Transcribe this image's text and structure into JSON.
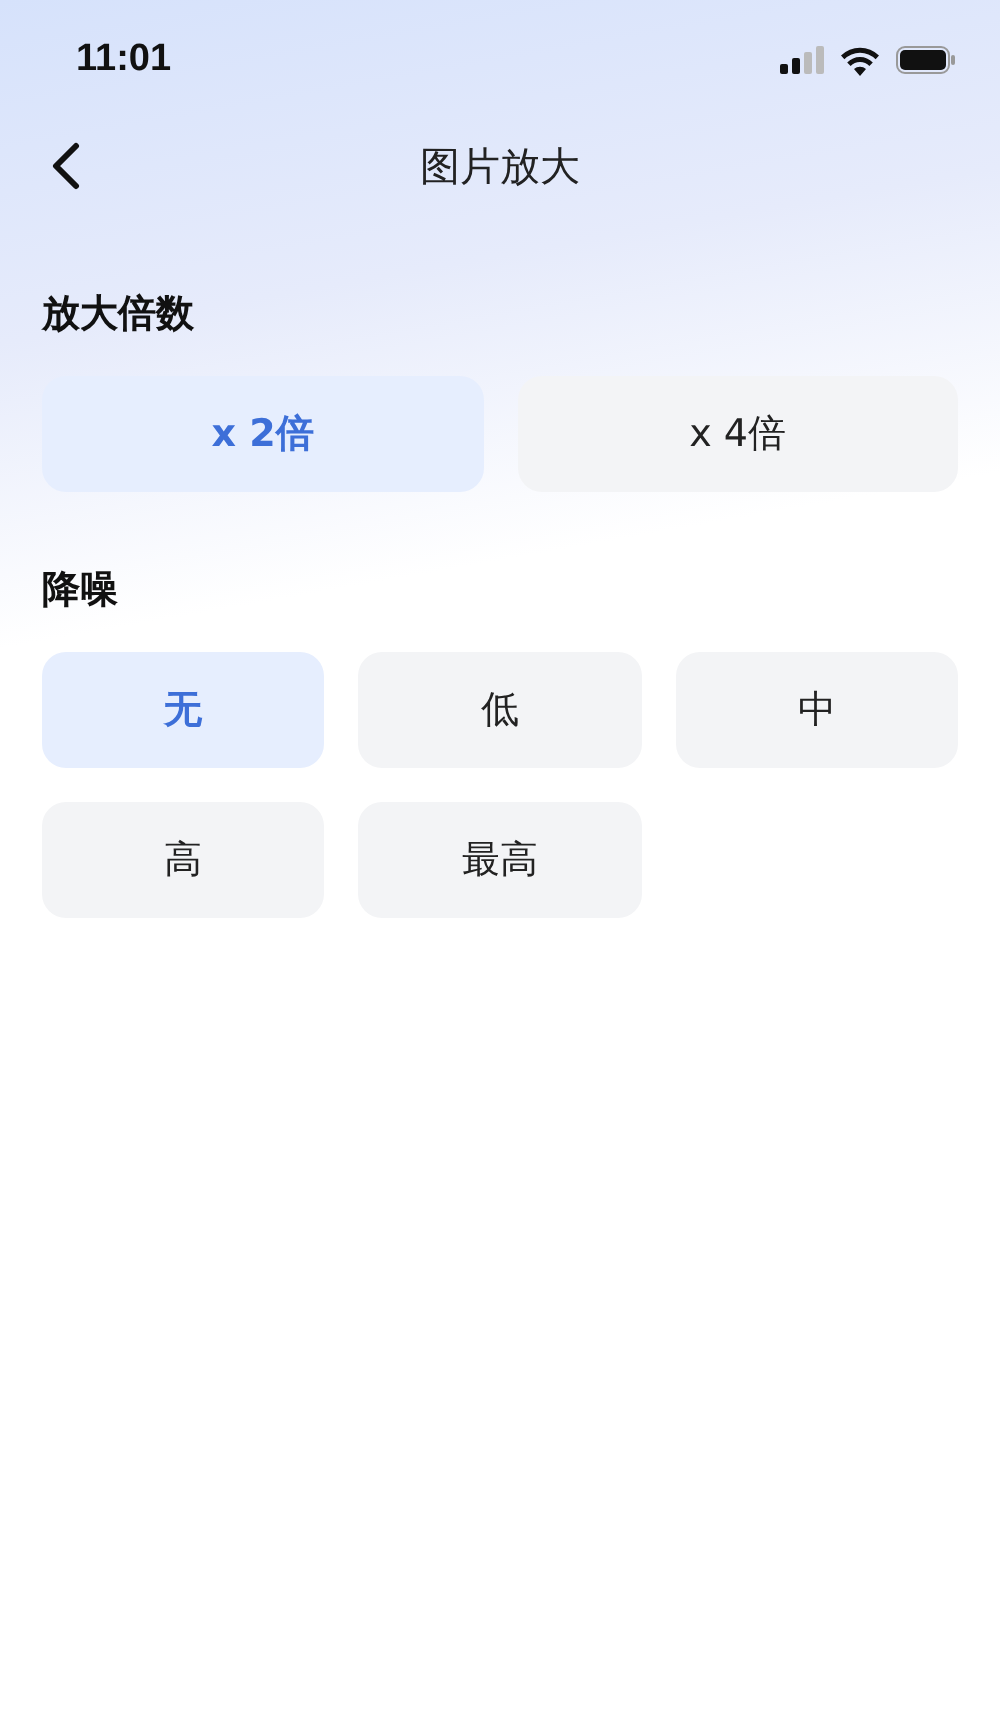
{
  "status_bar": {
    "time": "11:01"
  },
  "nav": {
    "title": "图片放大"
  },
  "sections": [
    {
      "title": "放大倍数",
      "kind": "wide",
      "options": [
        {
          "label": "x 2倍",
          "selected": true
        },
        {
          "label": "x 4倍",
          "selected": false
        }
      ]
    },
    {
      "title": "降噪",
      "kind": "compact",
      "options": [
        {
          "label": "无",
          "selected": true
        },
        {
          "label": "低",
          "selected": false
        },
        {
          "label": "中",
          "selected": false
        },
        {
          "label": "高",
          "selected": false
        },
        {
          "label": "最高",
          "selected": false
        }
      ]
    }
  ]
}
